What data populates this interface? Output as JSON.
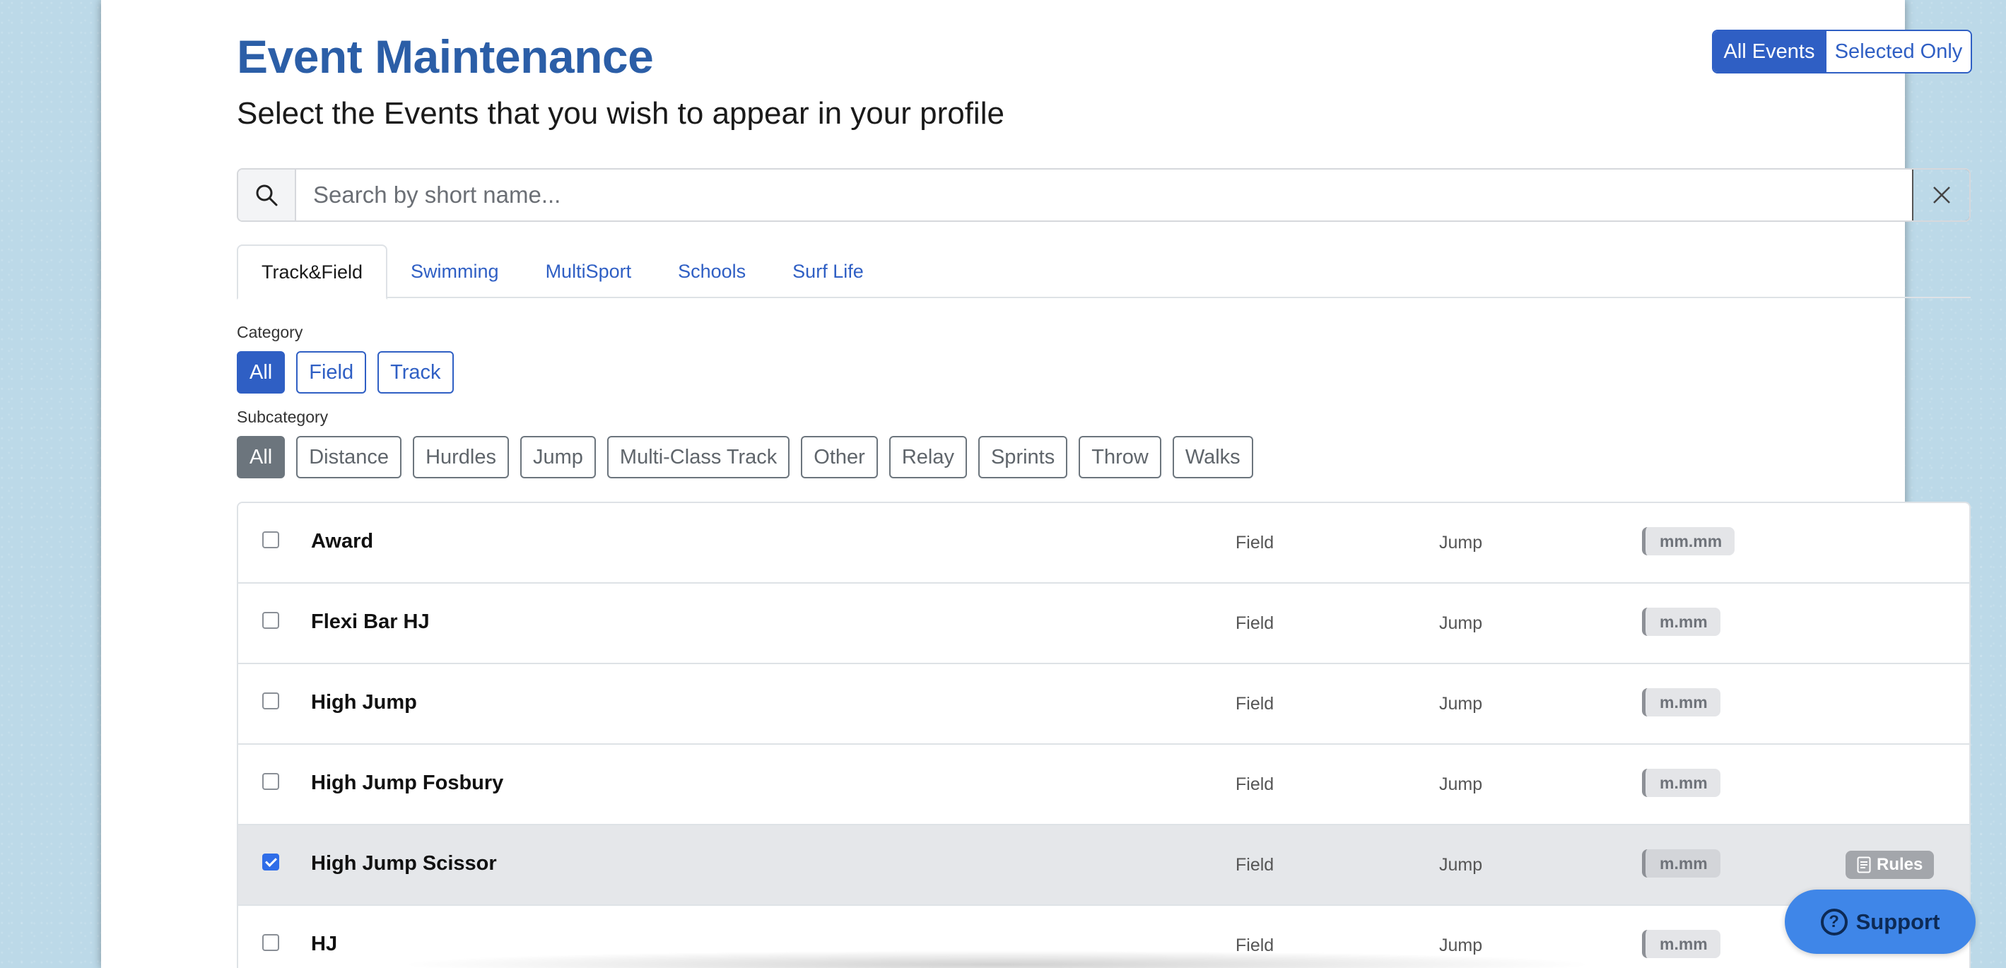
{
  "header": {
    "title": "Event Maintenance",
    "subtitle": "Select the Events that you wish to appear in your profile"
  },
  "view_toggle": {
    "all": "All Events",
    "selected": "Selected Only",
    "active": "all"
  },
  "search": {
    "placeholder": "Search by short name...",
    "value": ""
  },
  "tabs": [
    {
      "label": "Track&Field",
      "active": true
    },
    {
      "label": "Swimming"
    },
    {
      "label": "MultiSport"
    },
    {
      "label": "Schools"
    },
    {
      "label": "Surf Life"
    }
  ],
  "category": {
    "label": "Category",
    "options": [
      "All",
      "Field",
      "Track"
    ],
    "active": "All"
  },
  "subcategory": {
    "label": "Subcategory",
    "options": [
      "All",
      "Distance",
      "Hurdles",
      "Jump",
      "Multi-Class Track",
      "Other",
      "Relay",
      "Sprints",
      "Throw",
      "Walks"
    ],
    "active": "All"
  },
  "events": [
    {
      "name": "Award",
      "category": "Field",
      "subcategory": "Jump",
      "format": "mm.mm",
      "checked": false
    },
    {
      "name": "Flexi Bar HJ",
      "category": "Field",
      "subcategory": "Jump",
      "format": "m.mm",
      "checked": false
    },
    {
      "name": "High Jump",
      "category": "Field",
      "subcategory": "Jump",
      "format": "m.mm",
      "checked": false
    },
    {
      "name": "High Jump Fosbury",
      "category": "Field",
      "subcategory": "Jump",
      "format": "m.mm",
      "checked": false
    },
    {
      "name": "High Jump Scissor",
      "category": "Field",
      "subcategory": "Jump",
      "format": "m.mm",
      "checked": true,
      "rules": "Rules"
    },
    {
      "name": "HJ",
      "category": "Field",
      "subcategory": "Jump",
      "format": "m.mm",
      "checked": false
    }
  ],
  "support": {
    "label": "Support"
  },
  "colors": {
    "brand": "#2b5ea7",
    "accent": "#2f5fc4",
    "support": "#3f86e8"
  }
}
